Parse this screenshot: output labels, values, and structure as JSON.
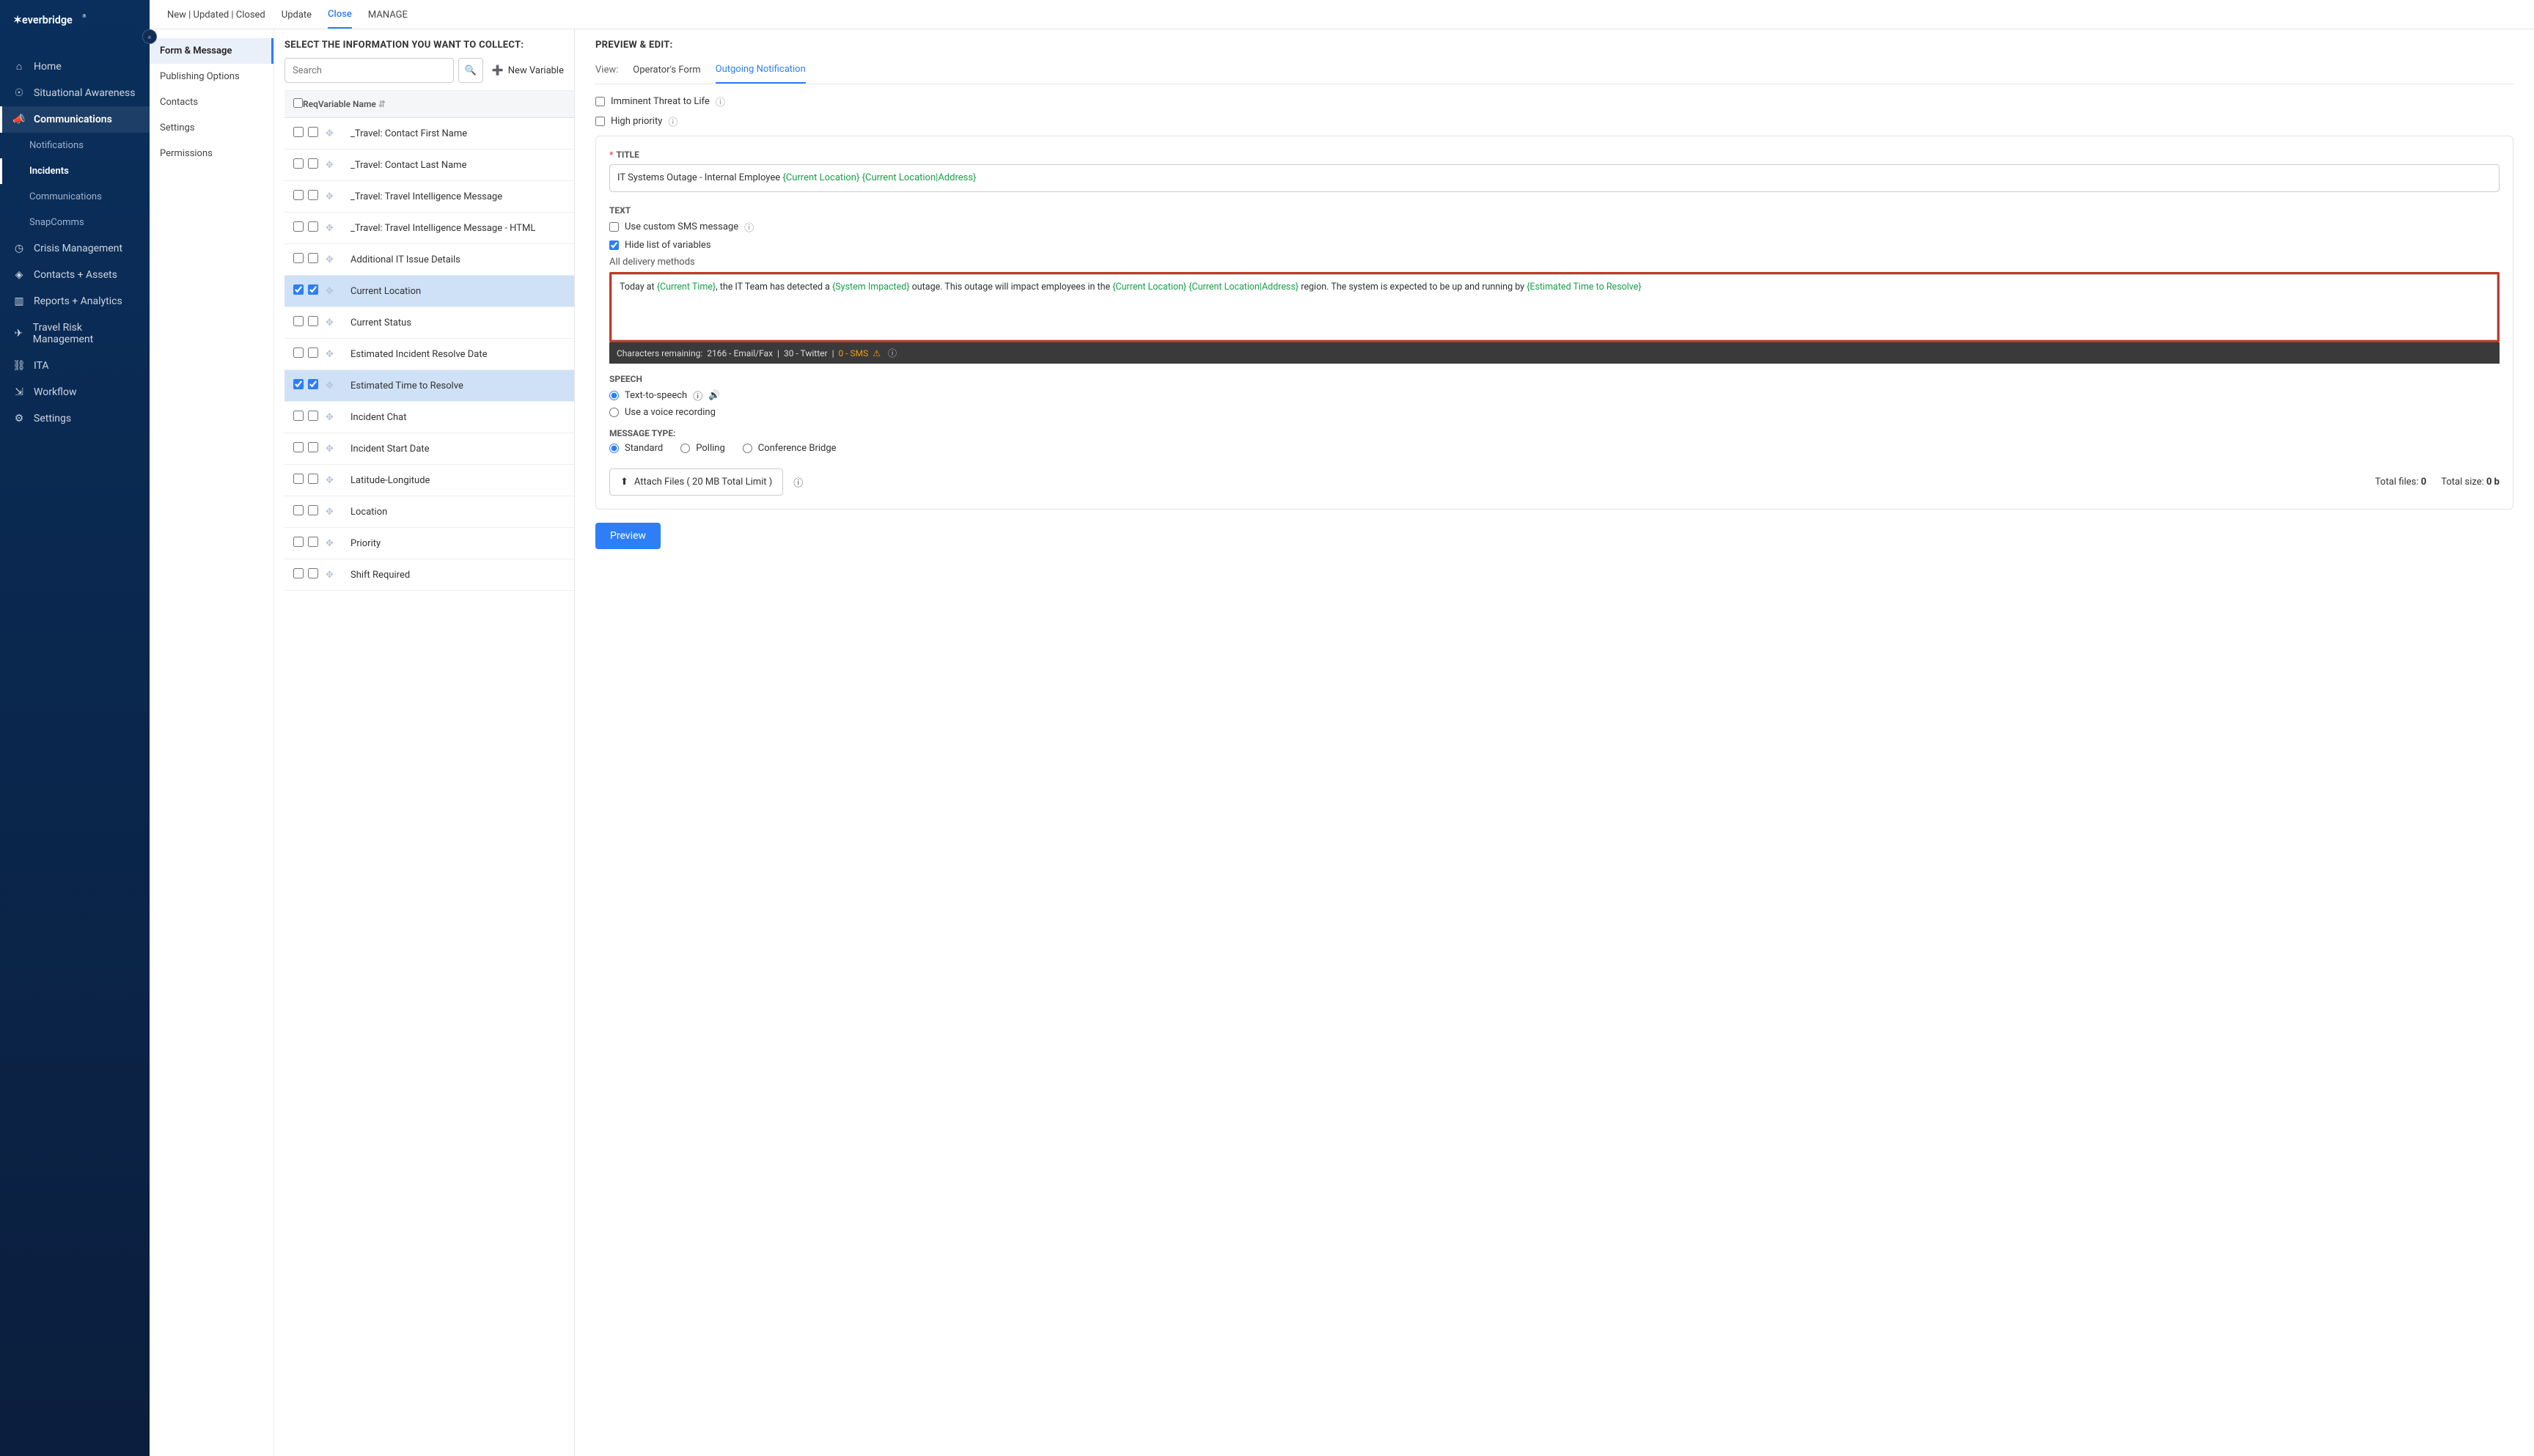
{
  "brand": "everbridge",
  "nav": {
    "collapse_glyph": "«",
    "items": [
      {
        "label": "Home",
        "icon": "home"
      },
      {
        "label": "Situational Awareness",
        "icon": "binoculars"
      },
      {
        "label": "Communications",
        "icon": "megaphone",
        "active": true,
        "children": [
          {
            "label": "Notifications"
          },
          {
            "label": "Incidents",
            "active": true
          },
          {
            "label": "Communications"
          },
          {
            "label": "SnapComms"
          }
        ]
      },
      {
        "label": "Crisis Management",
        "icon": "clock"
      },
      {
        "label": "Contacts + Assets",
        "icon": "pin"
      },
      {
        "label": "Reports + Analytics",
        "icon": "chart"
      },
      {
        "label": "Travel Risk Management",
        "icon": "plane"
      },
      {
        "label": "ITA",
        "icon": "link"
      },
      {
        "label": "Workflow",
        "icon": "flow"
      },
      {
        "label": "Settings",
        "icon": "gear"
      }
    ]
  },
  "topbar": {
    "segments": [
      {
        "label": "New | Updated | Closed"
      },
      {
        "label": "Update"
      },
      {
        "label": "Close",
        "active": true
      },
      {
        "label": "MANAGE"
      }
    ]
  },
  "left_panel": {
    "items": [
      {
        "label": "Form & Message",
        "selected": true
      },
      {
        "label": "Publishing Options"
      },
      {
        "label": "Contacts"
      },
      {
        "label": "Settings"
      },
      {
        "label": "Permissions"
      }
    ]
  },
  "mid_panel": {
    "heading": "SELECT THE INFORMATION YOU WANT TO COLLECT:",
    "search_placeholder": "Search",
    "new_variable_label": "New Variable",
    "columns": {
      "req": "Req",
      "name": "Variable Name"
    },
    "rows": [
      {
        "name": "_Travel: Contact First Name",
        "truncated": true
      },
      {
        "name": "_Travel: Contact Last Name"
      },
      {
        "name": "_Travel: Travel Intelligence Message"
      },
      {
        "name": "_Travel: Travel Intelligence Message - HTML"
      },
      {
        "name": "Additional IT Issue Details"
      },
      {
        "name": "Current Location",
        "sel": true,
        "c1": true,
        "c2": true
      },
      {
        "name": "Current Status"
      },
      {
        "name": "Estimated Incident Resolve Date"
      },
      {
        "name": "Estimated Time to Resolve",
        "sel": true,
        "c1": true,
        "c2": true
      },
      {
        "name": "Incident Chat"
      },
      {
        "name": "Incident Start Date"
      },
      {
        "name": "Latitude-Longitude"
      },
      {
        "name": "Location"
      },
      {
        "name": "Priority"
      },
      {
        "name": "Shift Required"
      }
    ]
  },
  "right_panel": {
    "heading": "PREVIEW & EDIT:",
    "view_label": "View:",
    "view_tabs": [
      {
        "label": "Operator's Form"
      },
      {
        "label": "Outgoing Notification",
        "active": true
      }
    ],
    "flags": {
      "imminent": "Imminent Threat to Life",
      "high_priority": "High priority"
    },
    "title_label": "TITLE",
    "title_prefix": "IT Systems Outage - Internal Employee ",
    "title_var1": "{Current Location}",
    "title_var2": "{Current Location|Address}",
    "text_label": "TEXT",
    "custom_sms": "Use custom SMS message",
    "hide_vars": "Hide list of variables",
    "all_delivery": "All delivery methods",
    "msg": {
      "p1a": "Today at ",
      "v1": "{Current Time}",
      "p1b": ", the IT Team has detected a ",
      "v2": "{System Impacted}",
      "p1c": " outage.  This outage will impact employees in the ",
      "v3": "{Current Location}",
      "sp": " ",
      "v4": "{Current Location|Address}",
      "p2": " region.  The system is expected to be up and running by ",
      "v5": "{Estimated Time to Resolve}"
    },
    "char_bar": {
      "prefix": "Characters remaining:  ",
      "email": "2166 - Email/Fax",
      "sep": "  |  ",
      "twitter": "30 - Twitter",
      "sms": "0 - SMS"
    },
    "speech_label": "SPEECH",
    "tts": "Text-to-speech",
    "voice_rec": "Use a voice recording",
    "msg_type_label": "MESSAGE TYPE:",
    "msg_types": {
      "standard": "Standard",
      "polling": "Polling",
      "conf": "Conference Bridge"
    },
    "attach_label": "Attach Files ( 20 MB Total Limit )",
    "total_files_label": "Total files:",
    "total_files": "0",
    "total_size_label": "Total size:",
    "total_size": "0 b",
    "preview_btn": "Preview"
  }
}
